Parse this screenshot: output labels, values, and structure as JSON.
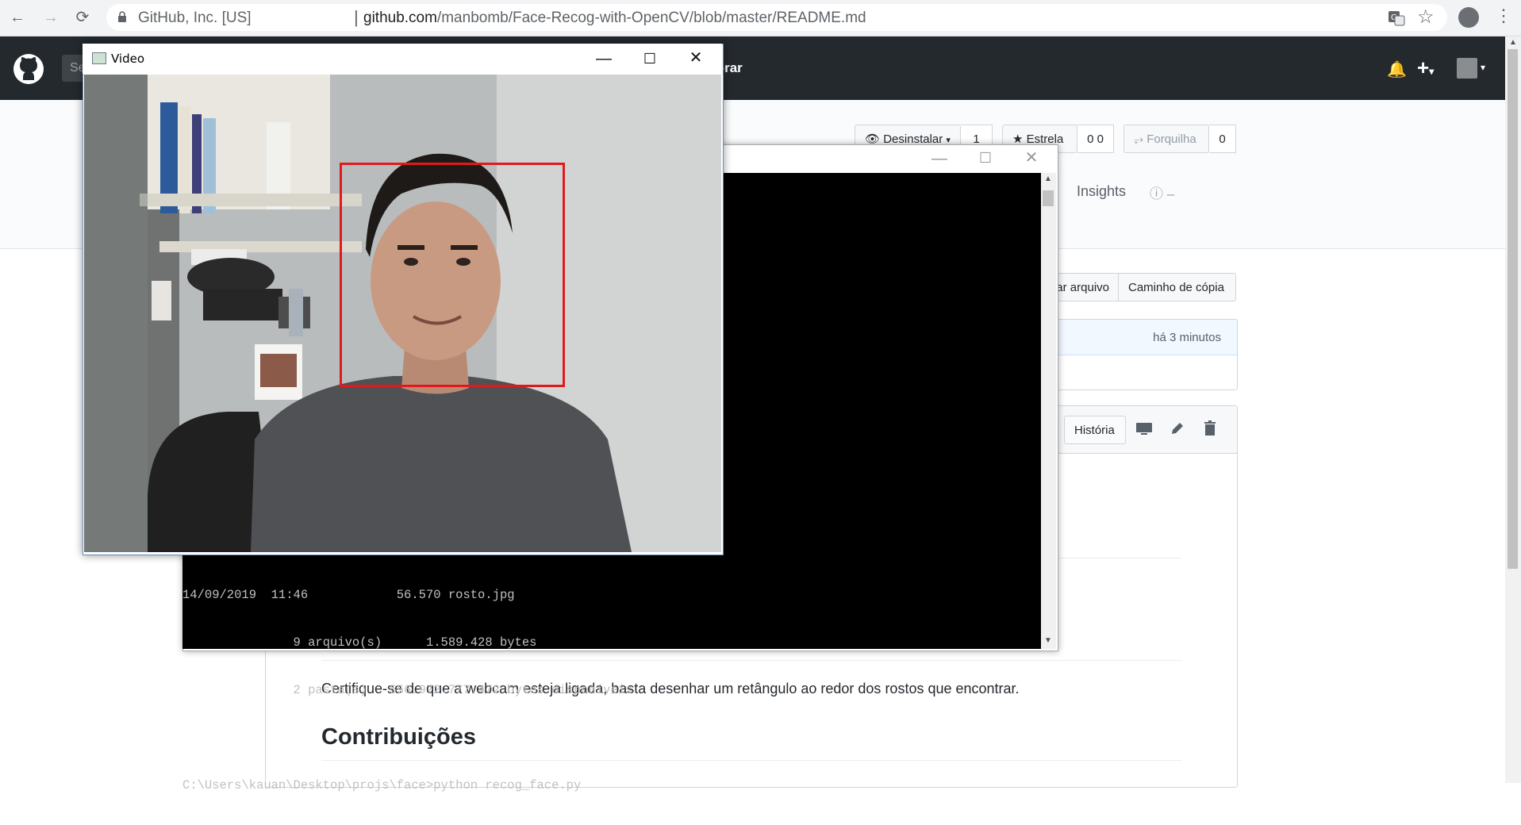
{
  "browser": {
    "site_identity": "GitHub, Inc. [US]",
    "separator": "|",
    "url_domain": "github.com",
    "url_path": "/manbomb/Face-Recog-with-OpenCV/blob/master/README.md",
    "icons": [
      "back-icon",
      "forward-icon",
      "reload-icon",
      "lock-icon",
      "translate-icon",
      "star-icon",
      "profile-avatar",
      "menu-icon"
    ]
  },
  "github": {
    "search_placeholder": "Se",
    "nav_explorar": "lorar",
    "watch_label": "Desinstalar",
    "watch_count": "1",
    "star_label": "Estrela",
    "star_count": "0 0",
    "fork_label": "Forquilha",
    "fork_count": "0",
    "tab_insights": "Insights",
    "find_file_label": "ar arquivo",
    "copy_path_label": "Caminho de cópia",
    "commit_time": "há 3 minutos",
    "history_label": "História",
    "readme_paragraph": "Certifique-se de que a webcam esteja ligada, basta desenhar um retângulo ao redor dos rostos que encontrar.",
    "readme_heading": "Contribuições"
  },
  "console": {
    "lines": [
      "14/09/2019  11:46            56.570 rosto.jpg",
      "               9 arquivo(s)      1.589.428 bytes",
      "               2 pasta(s)   556.972.777.472 bytes disponíveis",
      "",
      "C:\\Users\\kauan\\Desktop\\projs\\face>python recog_face.py"
    ]
  },
  "video_window": {
    "title": "Video"
  },
  "colors": {
    "github_header": "#24292e",
    "detection_box": "#e0191c",
    "link_blue": "#0366d6"
  }
}
